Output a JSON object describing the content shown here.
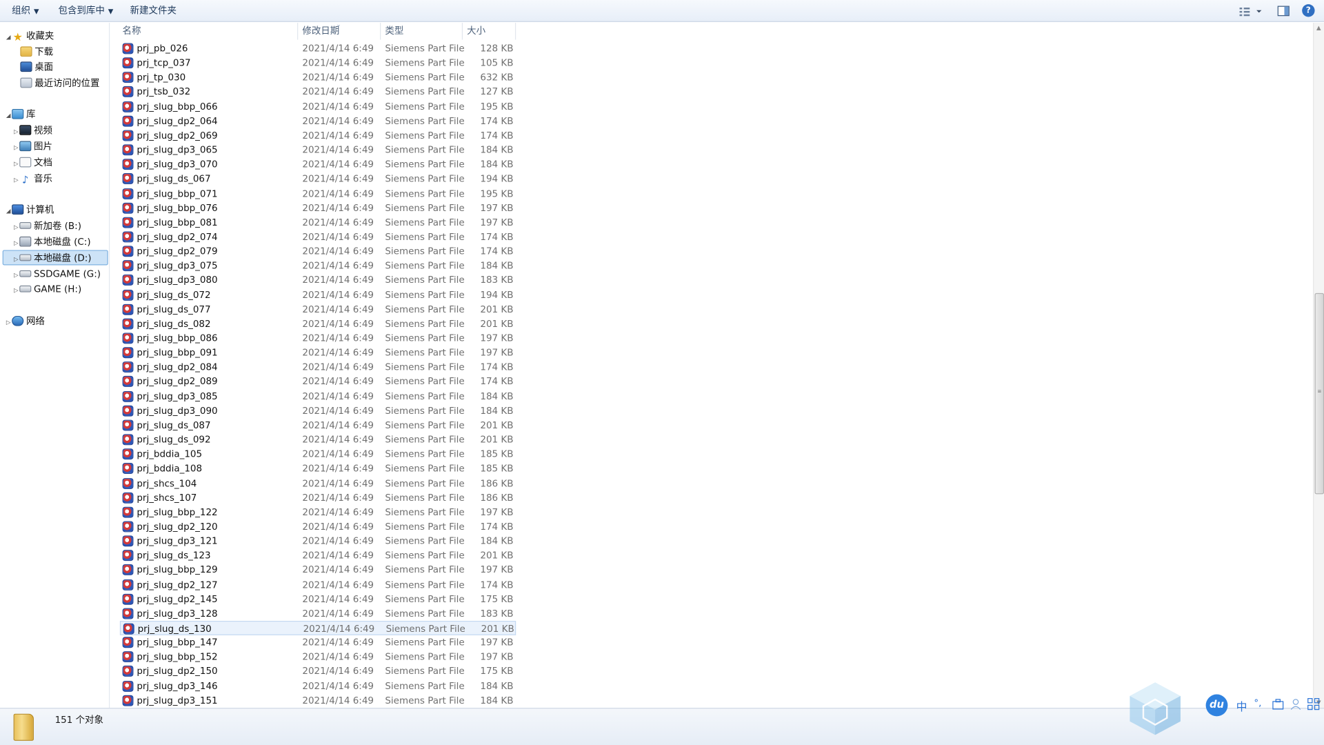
{
  "toolbar": {
    "organize": "组织",
    "include_in_library": "包含到库中",
    "new_folder": "新建文件夹",
    "help": "?"
  },
  "nav": {
    "favorites": "收藏夹",
    "downloads": "下载",
    "desktop": "桌面",
    "recent": "最近访问的位置",
    "libraries": "库",
    "videos": "视频",
    "pictures": "图片",
    "documents": "文档",
    "music": "音乐",
    "computer": "计算机",
    "drive_b": "新加卷 (B:)",
    "drive_c": "本地磁盘 (C:)",
    "drive_d": "本地磁盘 (D:)",
    "drive_g": "SSDGAME (G:)",
    "drive_h": "GAME (H:)",
    "network": "网络"
  },
  "columns": {
    "name": "名称",
    "date": "修改日期",
    "type": "类型",
    "size": "大小"
  },
  "files": [
    {
      "name": "prj_pb_026",
      "date": "2021/4/14 6:49",
      "type": "Siemens Part File",
      "size": "128 KB"
    },
    {
      "name": "prj_tcp_037",
      "date": "2021/4/14 6:49",
      "type": "Siemens Part File",
      "size": "105 KB"
    },
    {
      "name": "prj_tp_030",
      "date": "2021/4/14 6:49",
      "type": "Siemens Part File",
      "size": "632 KB"
    },
    {
      "name": "prj_tsb_032",
      "date": "2021/4/14 6:49",
      "type": "Siemens Part File",
      "size": "127 KB"
    },
    {
      "name": "prj_slug_bbp_066",
      "date": "2021/4/14 6:49",
      "type": "Siemens Part File",
      "size": "195 KB"
    },
    {
      "name": "prj_slug_dp2_064",
      "date": "2021/4/14 6:49",
      "type": "Siemens Part File",
      "size": "174 KB"
    },
    {
      "name": "prj_slug_dp2_069",
      "date": "2021/4/14 6:49",
      "type": "Siemens Part File",
      "size": "174 KB"
    },
    {
      "name": "prj_slug_dp3_065",
      "date": "2021/4/14 6:49",
      "type": "Siemens Part File",
      "size": "184 KB"
    },
    {
      "name": "prj_slug_dp3_070",
      "date": "2021/4/14 6:49",
      "type": "Siemens Part File",
      "size": "184 KB"
    },
    {
      "name": "prj_slug_ds_067",
      "date": "2021/4/14 6:49",
      "type": "Siemens Part File",
      "size": "194 KB"
    },
    {
      "name": "prj_slug_bbp_071",
      "date": "2021/4/14 6:49",
      "type": "Siemens Part File",
      "size": "195 KB"
    },
    {
      "name": "prj_slug_bbp_076",
      "date": "2021/4/14 6:49",
      "type": "Siemens Part File",
      "size": "197 KB"
    },
    {
      "name": "prj_slug_bbp_081",
      "date": "2021/4/14 6:49",
      "type": "Siemens Part File",
      "size": "197 KB"
    },
    {
      "name": "prj_slug_dp2_074",
      "date": "2021/4/14 6:49",
      "type": "Siemens Part File",
      "size": "174 KB"
    },
    {
      "name": "prj_slug_dp2_079",
      "date": "2021/4/14 6:49",
      "type": "Siemens Part File",
      "size": "174 KB"
    },
    {
      "name": "prj_slug_dp3_075",
      "date": "2021/4/14 6:49",
      "type": "Siemens Part File",
      "size": "184 KB"
    },
    {
      "name": "prj_slug_dp3_080",
      "date": "2021/4/14 6:49",
      "type": "Siemens Part File",
      "size": "183 KB"
    },
    {
      "name": "prj_slug_ds_072",
      "date": "2021/4/14 6:49",
      "type": "Siemens Part File",
      "size": "194 KB"
    },
    {
      "name": "prj_slug_ds_077",
      "date": "2021/4/14 6:49",
      "type": "Siemens Part File",
      "size": "201 KB"
    },
    {
      "name": "prj_slug_ds_082",
      "date": "2021/4/14 6:49",
      "type": "Siemens Part File",
      "size": "201 KB"
    },
    {
      "name": "prj_slug_bbp_086",
      "date": "2021/4/14 6:49",
      "type": "Siemens Part File",
      "size": "197 KB"
    },
    {
      "name": "prj_slug_bbp_091",
      "date": "2021/4/14 6:49",
      "type": "Siemens Part File",
      "size": "197 KB"
    },
    {
      "name": "prj_slug_dp2_084",
      "date": "2021/4/14 6:49",
      "type": "Siemens Part File",
      "size": "174 KB"
    },
    {
      "name": "prj_slug_dp2_089",
      "date": "2021/4/14 6:49",
      "type": "Siemens Part File",
      "size": "174 KB"
    },
    {
      "name": "prj_slug_dp3_085",
      "date": "2021/4/14 6:49",
      "type": "Siemens Part File",
      "size": "184 KB"
    },
    {
      "name": "prj_slug_dp3_090",
      "date": "2021/4/14 6:49",
      "type": "Siemens Part File",
      "size": "184 KB"
    },
    {
      "name": "prj_slug_ds_087",
      "date": "2021/4/14 6:49",
      "type": "Siemens Part File",
      "size": "201 KB"
    },
    {
      "name": "prj_slug_ds_092",
      "date": "2021/4/14 6:49",
      "type": "Siemens Part File",
      "size": "201 KB"
    },
    {
      "name": "prj_bddia_105",
      "date": "2021/4/14 6:49",
      "type": "Siemens Part File",
      "size": "185 KB"
    },
    {
      "name": "prj_bddia_108",
      "date": "2021/4/14 6:49",
      "type": "Siemens Part File",
      "size": "185 KB"
    },
    {
      "name": "prj_shcs_104",
      "date": "2021/4/14 6:49",
      "type": "Siemens Part File",
      "size": "186 KB"
    },
    {
      "name": "prj_shcs_107",
      "date": "2021/4/14 6:49",
      "type": "Siemens Part File",
      "size": "186 KB"
    },
    {
      "name": "prj_slug_bbp_122",
      "date": "2021/4/14 6:49",
      "type": "Siemens Part File",
      "size": "197 KB"
    },
    {
      "name": "prj_slug_dp2_120",
      "date": "2021/4/14 6:49",
      "type": "Siemens Part File",
      "size": "174 KB"
    },
    {
      "name": "prj_slug_dp3_121",
      "date": "2021/4/14 6:49",
      "type": "Siemens Part File",
      "size": "184 KB"
    },
    {
      "name": "prj_slug_ds_123",
      "date": "2021/4/14 6:49",
      "type": "Siemens Part File",
      "size": "201 KB"
    },
    {
      "name": "prj_slug_bbp_129",
      "date": "2021/4/14 6:49",
      "type": "Siemens Part File",
      "size": "197 KB"
    },
    {
      "name": "prj_slug_dp2_127",
      "date": "2021/4/14 6:49",
      "type": "Siemens Part File",
      "size": "174 KB"
    },
    {
      "name": "prj_slug_dp2_145",
      "date": "2021/4/14 6:49",
      "type": "Siemens Part File",
      "size": "175 KB"
    },
    {
      "name": "prj_slug_dp3_128",
      "date": "2021/4/14 6:49",
      "type": "Siemens Part File",
      "size": "183 KB"
    },
    {
      "name": "prj_slug_ds_130",
      "date": "2021/4/14 6:49",
      "type": "Siemens Part File",
      "size": "201 KB",
      "selected": true
    },
    {
      "name": "prj_slug_bbp_147",
      "date": "2021/4/14 6:49",
      "type": "Siemens Part File",
      "size": "197 KB"
    },
    {
      "name": "prj_slug_bbp_152",
      "date": "2021/4/14 6:49",
      "type": "Siemens Part File",
      "size": "197 KB"
    },
    {
      "name": "prj_slug_dp2_150",
      "date": "2021/4/14 6:49",
      "type": "Siemens Part File",
      "size": "175 KB"
    },
    {
      "name": "prj_slug_dp3_146",
      "date": "2021/4/14 6:49",
      "type": "Siemens Part File",
      "size": "184 KB"
    },
    {
      "name": "prj_slug_dp3_151",
      "date": "2021/4/14 6:49",
      "type": "Siemens Part File",
      "size": "184 KB"
    }
  ],
  "status": {
    "count": "151 个对象"
  },
  "tray": {
    "du": "du",
    "ime_lang": "中",
    "ime_punct": "°,",
    "icons": [
      "toolbox-icon",
      "user-icon",
      "grid-icon"
    ]
  },
  "colors": {
    "accent": "#2f6fc2",
    "selection": "#eaf2fc",
    "file_icon": "#2b56b8"
  }
}
